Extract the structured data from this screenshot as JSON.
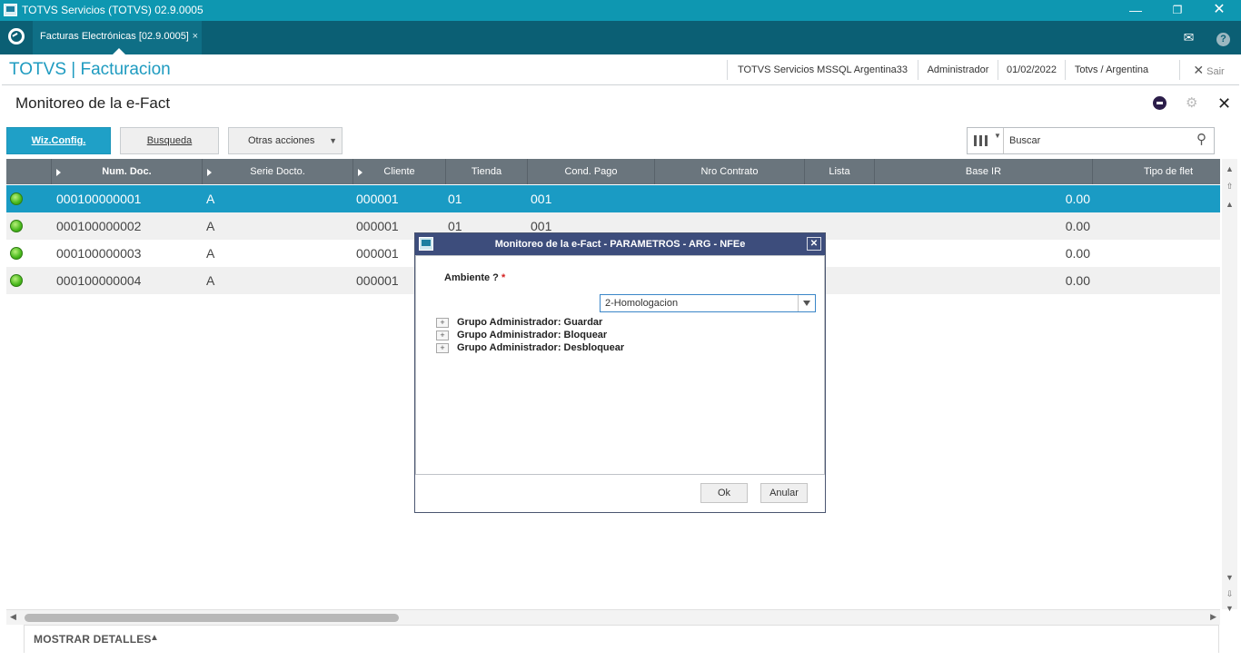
{
  "window": {
    "title": "TOTVS Servicios (TOTVS) 02.9.0005"
  },
  "tabs": [
    {
      "label": "Facturas Electrónicas [02.9.0005]"
    }
  ],
  "header": {
    "brand": "TOTVS | Facturacion",
    "environment": "TOTVS Servicios MSSQL Argentina33",
    "user": "Administrador",
    "date": "01/02/2022",
    "company": "Totvs / Argentina",
    "exit_label": "Sair"
  },
  "page": {
    "title": "Monitoreo de la e-Fact"
  },
  "toolbar": {
    "wiz_label": "Wiz.Config.",
    "busqueda_label": "Busqueda",
    "otras_label": "Otras acciones",
    "search_placeholder": "Buscar"
  },
  "grid": {
    "columns": [
      "Num. Doc.",
      "Serie Docto.",
      "Cliente",
      "Tienda",
      "Cond. Pago",
      "Nro Contrato",
      "Lista",
      "Base IR",
      "Tipo de flet"
    ],
    "rows": [
      {
        "num": "000100000001",
        "serie": "A",
        "cliente": "000001",
        "tienda": "01",
        "cond": "001",
        "base": "0.00"
      },
      {
        "num": "000100000002",
        "serie": "A",
        "cliente": "000001",
        "tienda": "01",
        "cond": "001",
        "base": "0.00"
      },
      {
        "num": "000100000003",
        "serie": "A",
        "cliente": "000001",
        "tienda": "",
        "cond": "",
        "base": "0.00"
      },
      {
        "num": "000100000004",
        "serie": "A",
        "cliente": "000001",
        "tienda": "",
        "cond": "",
        "base": "0.00"
      }
    ]
  },
  "footer": {
    "label": "MOSTRAR DETALLES"
  },
  "modal": {
    "title": "Monitoreo de la e-Fact - PARAMETROS - ARG - NFEe",
    "field_label": "Ambiente ?",
    "required_mark": "*",
    "select_value": "2-Homologacion",
    "groups": [
      "Grupo Administrador: Guardar",
      "Grupo Administrador: Bloquear",
      "Grupo Administrador: Desbloquear"
    ],
    "ok_label": "Ok",
    "cancel_label": "Anular"
  }
}
